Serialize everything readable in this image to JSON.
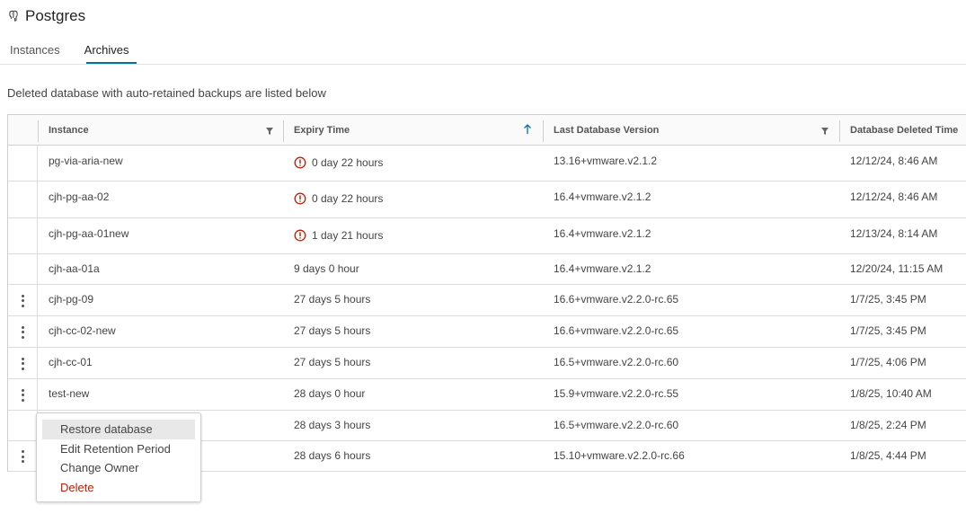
{
  "app": {
    "title": "Postgres",
    "icon": "postgres-elephant-icon"
  },
  "tabs": [
    {
      "label": "Instances",
      "active": false
    },
    {
      "label": "Archives",
      "active": true
    }
  ],
  "description": "Deleted database with auto-retained backups are listed below",
  "table": {
    "columns": [
      {
        "label": "Instance",
        "filter": true
      },
      {
        "label": "Expiry Time",
        "sort": "ascending"
      },
      {
        "label": "Last Database Version",
        "filter": true
      },
      {
        "label": "Database Deleted Time"
      }
    ],
    "rows": [
      {
        "instance": "pg-via-aria-new",
        "expiry": "0 day 22 hours",
        "warning": true,
        "version": "13.16+vmware.v2.1.2",
        "deleted": "12/12/24, 8:46 AM",
        "has_actions": false
      },
      {
        "instance": "cjh-pg-aa-02",
        "expiry": "0 day 22 hours",
        "warning": true,
        "version": "16.4+vmware.v2.1.2",
        "deleted": "12/12/24, 8:46 AM",
        "has_actions": false
      },
      {
        "instance": "cjh-pg-aa-01new",
        "expiry": "1 day 21 hours",
        "warning": true,
        "version": "16.4+vmware.v2.1.2",
        "deleted": "12/13/24, 8:14 AM",
        "has_actions": false
      },
      {
        "instance": "cjh-aa-01a",
        "expiry": "9 days 0 hour",
        "warning": false,
        "version": "16.4+vmware.v2.1.2",
        "deleted": "12/20/24, 11:15 AM",
        "has_actions": false
      },
      {
        "instance": "cjh-pg-09",
        "expiry": "27 days 5 hours",
        "warning": false,
        "version": "16.6+vmware.v2.2.0-rc.65",
        "deleted": "1/7/25, 3:45 PM",
        "has_actions": true
      },
      {
        "instance": "cjh-cc-02-new",
        "expiry": "27 days 5 hours",
        "warning": false,
        "version": "16.6+vmware.v2.2.0-rc.65",
        "deleted": "1/7/25, 3:45 PM",
        "has_actions": true
      },
      {
        "instance": "cjh-cc-01",
        "expiry": "27 days 5 hours",
        "warning": false,
        "version": "16.5+vmware.v2.2.0-rc.60",
        "deleted": "1/7/25, 4:06 PM",
        "has_actions": true
      },
      {
        "instance": "test-new",
        "expiry": "28 days 0 hour",
        "warning": false,
        "version": "15.9+vmware.v2.2.0-rc.55",
        "deleted": "1/8/25, 10:40 AM",
        "has_actions": true
      },
      {
        "instance": "",
        "expiry": "28 days 3 hours",
        "warning": false,
        "version": "16.5+vmware.v2.2.0-rc.60",
        "deleted": "1/8/25, 2:24 PM",
        "has_actions": false
      },
      {
        "instance": "",
        "expiry": "28 days 6 hours",
        "warning": false,
        "version": "15.10+vmware.v2.2.0-rc.66",
        "deleted": "1/8/25, 4:44 PM",
        "has_actions": true
      }
    ]
  },
  "context_menu": {
    "items": [
      {
        "label": "Restore database",
        "hovered": true,
        "danger": false
      },
      {
        "label": "Edit Retention Period",
        "hovered": false,
        "danger": false
      },
      {
        "label": "Change Owner",
        "hovered": false,
        "danger": false
      },
      {
        "label": "Delete",
        "hovered": false,
        "danger": true
      }
    ]
  },
  "colors": {
    "accent": "#0072a3",
    "warning": "#c21d00",
    "border": "#cfcfcf",
    "menu_hover": "#e8e8e8"
  }
}
